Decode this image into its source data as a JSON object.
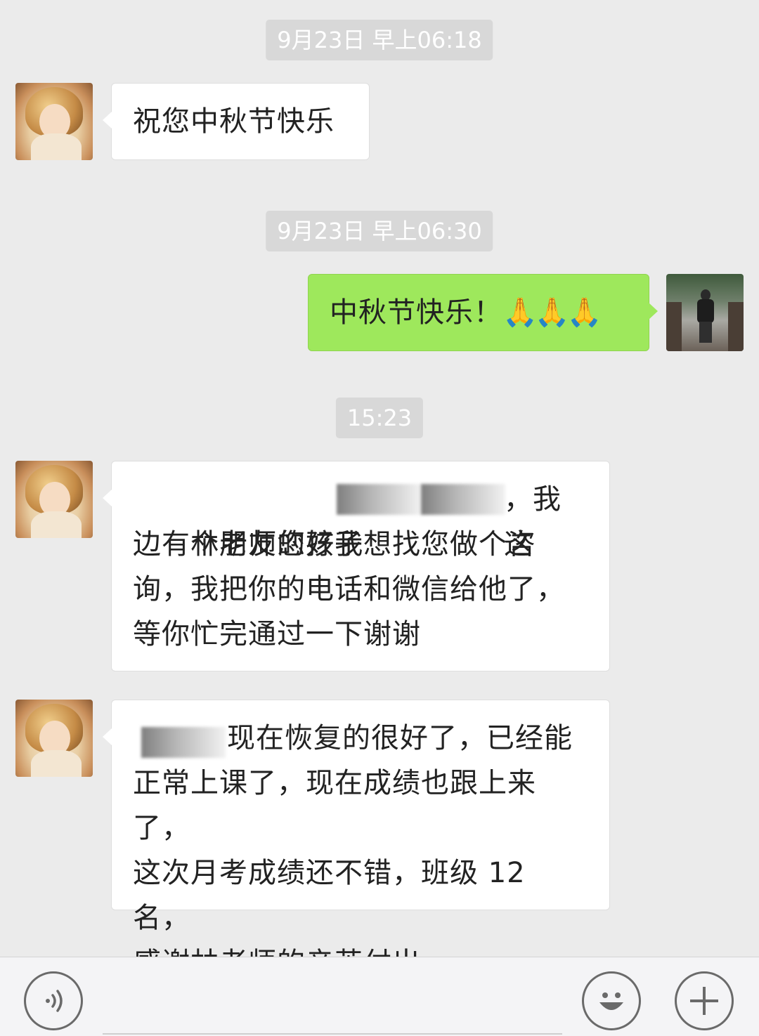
{
  "conversation": {
    "timestamps": [
      "9月23日 早上06:18",
      "9月23日 早上06:30",
      "15:23"
    ],
    "messages": [
      {
        "sender": "contact",
        "text": "祝您中秋节快乐"
      },
      {
        "sender": "me",
        "text": "中秋节快乐！",
        "emoji": "🙏🙏🙏"
      },
      {
        "sender": "contact",
        "line1_a": "林老师您好我",
        "line1_b": "，我这",
        "rest": "边有个朋友的孩子想找您做个咨\n询，我把你的电话和微信给他了，\n等你忙完通过一下谢谢"
      },
      {
        "sender": "contact",
        "line1": "现在恢复的很好了，已经能",
        "rest": "正常上课了，现在成绩也跟上来了，\n这次月考成绩还不错，班级 12 名，\n感谢林老师的辛苦付出"
      }
    ]
  },
  "icons": {
    "voice": "voice-icon",
    "emoji": "emoji-icon",
    "more": "plus-icon"
  },
  "colors": {
    "background": "#ebebeb",
    "bubble_incoming": "#ffffff",
    "bubble_outgoing": "#9ee85c",
    "timestamp_bg": "#d8d8d8"
  }
}
